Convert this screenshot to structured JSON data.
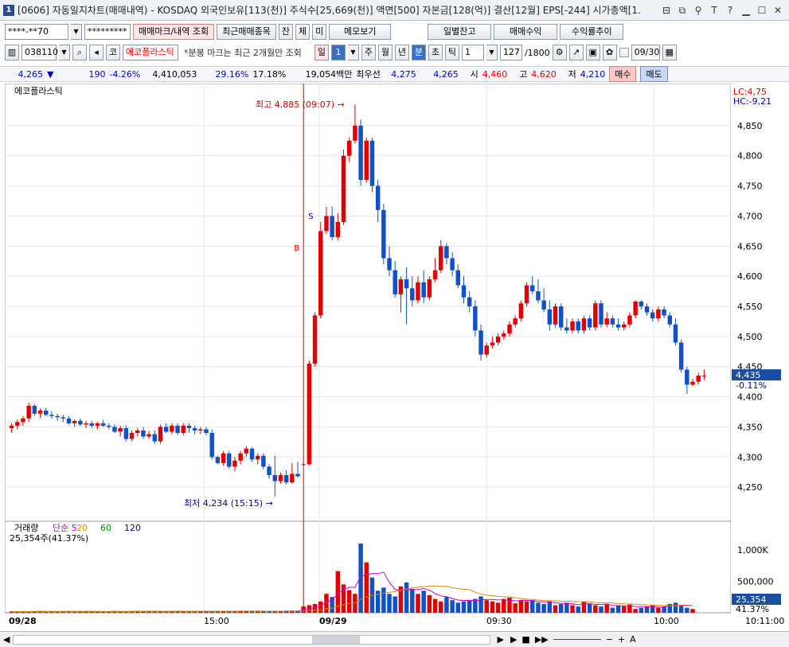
{
  "window": {
    "number": "1",
    "title": "[0606] 자동일지차트(매매내역) - KOSDAQ 외국인보유[113(천)] 주식수[25,669(천)] 액면[500] 자본금[128(억)] 결산[12월] EPS[-244] 시가총액[1."
  },
  "toolbar": {
    "account": "****-**70",
    "password": "*********",
    "btn_trade_mark": "매매마크/내역 조회",
    "btn_recent": "최근매매종목",
    "btn_jan": "잔",
    "btn_che": "체",
    "btn_mi": "미",
    "btn_memo": "메모보기",
    "btn_daily": "일별잔고",
    "btn_profit": "매매수익",
    "btn_return": "수익률추이"
  },
  "toolbar2": {
    "code": "038110",
    "market": "코",
    "name": "에코플라스틱",
    "note": "*분봉 마크는 최근 2개월만 조회",
    "period_il": "일",
    "period_num": "1",
    "ju": "주",
    "wol": "월",
    "nyeon": "년",
    "bun": "분",
    "cho": "초",
    "tick": "틱",
    "tick_num": "1",
    "count": "127",
    "count_total": "/1800",
    "date": "09/30"
  },
  "quote": {
    "price": "4,265",
    "arrow": "▼",
    "change": "190",
    "pct": "-4.26%",
    "volume": "4,410,053",
    "ratio": "29.16%",
    "ratio2": "17.18%",
    "amount": "19,054백만",
    "best_label": "최우선",
    "best_ask": "4,275",
    "best_bid": "4,265",
    "open_label": "시",
    "open": "4,460",
    "high_label": "고",
    "high": "4,620",
    "low_label": "저",
    "low": "4,210",
    "buy": "매수",
    "sell": "매도"
  },
  "chart_data": [
    {
      "type": "candlestick",
      "title": "에코플라스틱",
      "xlabel": "",
      "ylabel": "",
      "ylim": [
        4200,
        4900
      ],
      "y_ticks": [
        "4,850",
        "4,800",
        "4,750",
        "4,700",
        "4,650",
        "4,600",
        "4,550",
        "4,500",
        "4,450",
        "4,400",
        "4,350",
        "4,300",
        "4,250"
      ],
      "x_ticks": [
        "09/28",
        "15:00",
        "09/29",
        "09:30",
        "10:00",
        "10:11:00"
      ],
      "lc": "LC:4,75",
      "hc": "HC:-9,21",
      "current": "4,435",
      "current_pct": "-0.11%",
      "annotations": {
        "high": "최고 4,885 (09:07)",
        "low": "최저 4,234 (15:15)",
        "buy_mark": "B",
        "sell_mark": "S"
      },
      "candles": [
        [
          4348,
          4356,
          4340,
          4352
        ],
        [
          4352,
          4362,
          4346,
          4358
        ],
        [
          4358,
          4368,
          4352,
          4364
        ],
        [
          4364,
          4390,
          4358,
          4385
        ],
        [
          4385,
          4388,
          4368,
          4372
        ],
        [
          4372,
          4380,
          4365,
          4377
        ],
        [
          4377,
          4382,
          4368,
          4370
        ],
        [
          4370,
          4376,
          4364,
          4368
        ],
        [
          4368,
          4372,
          4360,
          4366
        ],
        [
          4366,
          4370,
          4358,
          4364
        ],
        [
          4364,
          4368,
          4354,
          4356
        ],
        [
          4356,
          4362,
          4350,
          4360
        ],
        [
          4360,
          4364,
          4352,
          4354
        ],
        [
          4354,
          4360,
          4348,
          4356
        ],
        [
          4356,
          4360,
          4348,
          4352
        ],
        [
          4352,
          4358,
          4346,
          4356
        ],
        [
          4356,
          4362,
          4350,
          4352
        ],
        [
          4352,
          4356,
          4346,
          4350
        ],
        [
          4350,
          4354,
          4340,
          4342
        ],
        [
          4342,
          4352,
          4334,
          4348
        ],
        [
          4348,
          4352,
          4326,
          4330
        ],
        [
          4330,
          4344,
          4326,
          4340
        ],
        [
          4340,
          4348,
          4334,
          4344
        ],
        [
          4344,
          4350,
          4330,
          4334
        ],
        [
          4334,
          4344,
          4330,
          4338
        ],
        [
          4338,
          4344,
          4322,
          4326
        ],
        [
          4326,
          4354,
          4322,
          4350
        ],
        [
          4350,
          4356,
          4340,
          4342
        ],
        [
          4342,
          4356,
          4338,
          4352
        ],
        [
          4352,
          4356,
          4336,
          4340
        ],
        [
          4340,
          4356,
          4336,
          4352
        ],
        [
          4352,
          4356,
          4340,
          4348
        ],
        [
          4348,
          4352,
          4338,
          4344
        ],
        [
          4344,
          4350,
          4338,
          4346
        ],
        [
          4346,
          4350,
          4336,
          4340
        ],
        [
          4340,
          4346,
          4296,
          4300
        ],
        [
          4300,
          4302,
          4288,
          4290
        ],
        [
          4290,
          4310,
          4286,
          4306
        ],
        [
          4306,
          4310,
          4280,
          4284
        ],
        [
          4284,
          4300,
          4276,
          4294
        ],
        [
          4294,
          4310,
          4288,
          4306
        ],
        [
          4306,
          4318,
          4300,
          4314
        ],
        [
          4314,
          4316,
          4292,
          4296
        ],
        [
          4296,
          4306,
          4288,
          4302
        ],
        [
          4302,
          4306,
          4280,
          4284
        ],
        [
          4284,
          4288,
          4264,
          4270
        ],
        [
          4270,
          4302,
          4234,
          4260
        ],
        [
          4260,
          4274,
          4256,
          4270
        ],
        [
          4270,
          4278,
          4254,
          4258
        ],
        [
          4258,
          4290,
          4256,
          4272
        ],
        [
          4272,
          4292,
          4266,
          4268
        ],
        [
          4288,
          4290,
          4286,
          4288
        ],
        [
          4288,
          4460,
          4286,
          4455
        ],
        [
          4455,
          4540,
          4450,
          4535
        ],
        [
          4535,
          4690,
          4530,
          4675
        ],
        [
          4675,
          4715,
          4670,
          4700
        ],
        [
          4700,
          4716,
          4660,
          4665
        ],
        [
          4665,
          4705,
          4660,
          4690
        ],
        [
          4690,
          4810,
          4685,
          4800
        ],
        [
          4800,
          4830,
          4790,
          4825
        ],
        [
          4825,
          4885,
          4820,
          4850
        ],
        [
          4850,
          4860,
          4750,
          4760
        ],
        [
          4760,
          4830,
          4755,
          4825
        ],
        [
          4825,
          4830,
          4740,
          4750
        ],
        [
          4750,
          4760,
          4690,
          4710
        ],
        [
          4710,
          4720,
          4620,
          4630
        ],
        [
          4630,
          4650,
          4600,
          4610
        ],
        [
          4610,
          4625,
          4565,
          4570
        ],
        [
          4570,
          4600,
          4540,
          4595
        ],
        [
          4595,
          4615,
          4520,
          4580
        ],
        [
          4580,
          4600,
          4550,
          4560
        ],
        [
          4560,
          4600,
          4555,
          4590
        ],
        [
          4590,
          4610,
          4555,
          4565
        ],
        [
          4565,
          4600,
          4560,
          4595
        ],
        [
          4595,
          4630,
          4590,
          4610
        ],
        [
          4610,
          4660,
          4605,
          4650
        ],
        [
          4650,
          4655,
          4620,
          4630
        ],
        [
          4630,
          4640,
          4600,
          4610
        ],
        [
          4610,
          4620,
          4580,
          4585
        ],
        [
          4585,
          4600,
          4555,
          4565
        ],
        [
          4565,
          4575,
          4540,
          4550
        ],
        [
          4550,
          4560,
          4500,
          4510
        ],
        [
          4510,
          4520,
          4460,
          4470
        ],
        [
          4470,
          4490,
          4465,
          4485
        ],
        [
          4485,
          4500,
          4480,
          4490
        ],
        [
          4490,
          4505,
          4485,
          4500
        ],
        [
          4500,
          4510,
          4495,
          4505
        ],
        [
          4505,
          4525,
          4500,
          4520
        ],
        [
          4520,
          4535,
          4515,
          4530
        ],
        [
          4530,
          4560,
          4525,
          4555
        ],
        [
          4555,
          4590,
          4550,
          4585
        ],
        [
          4585,
          4600,
          4570,
          4575
        ],
        [
          4575,
          4595,
          4555,
          4560
        ],
        [
          4560,
          4580,
          4540,
          4545
        ],
        [
          4545,
          4560,
          4510,
          4520
        ],
        [
          4520,
          4555,
          4515,
          4550
        ],
        [
          4550,
          4555,
          4510,
          4515
        ],
        [
          4515,
          4530,
          4505,
          4510
        ],
        [
          4510,
          4530,
          4505,
          4525
        ],
        [
          4525,
          4530,
          4505,
          4510
        ],
        [
          4510,
          4535,
          4505,
          4530
        ],
        [
          4530,
          4535,
          4510,
          4515
        ],
        [
          4515,
          4560,
          4510,
          4555
        ],
        [
          4555,
          4560,
          4515,
          4520
        ],
        [
          4520,
          4540,
          4515,
          4530
        ],
        [
          4530,
          4535,
          4515,
          4520
        ],
        [
          4520,
          4530,
          4510,
          4515
        ],
        [
          4515,
          4525,
          4510,
          4520
        ],
        [
          4520,
          4540,
          4515,
          4535
        ],
        [
          4535,
          4560,
          4530,
          4558
        ],
        [
          4558,
          4560,
          4545,
          4550
        ],
        [
          4550,
          4555,
          4535,
          4540
        ],
        [
          4540,
          4545,
          4525,
          4530
        ],
        [
          4530,
          4550,
          4525,
          4545
        ],
        [
          4545,
          4550,
          4530,
          4535
        ],
        [
          4535,
          4540,
          4515,
          4520
        ],
        [
          4520,
          4530,
          4485,
          4490
        ],
        [
          4490,
          4495,
          4440,
          4445
        ],
        [
          4445,
          4450,
          4405,
          4420
        ],
        [
          4420,
          4430,
          4418,
          4425
        ],
        [
          4425,
          4440,
          4420,
          4435
        ],
        [
          4435,
          4445,
          4428,
          4435
        ]
      ]
    },
    {
      "type": "bar",
      "title": "거래량",
      "series_labels": [
        "단순 5",
        "20",
        "60",
        "120"
      ],
      "series_colors": [
        "#d000d0",
        "#d09000",
        "#009000",
        "#000080"
      ],
      "volume_text": "25,354주(41.37%)",
      "y_ticks": [
        "1,000K",
        "500,000"
      ],
      "current_volume": "25,354",
      "current_pct": "41.37%",
      "values": [
        20,
        15,
        25,
        18,
        22,
        30,
        14,
        20,
        18,
        25,
        28,
        16,
        22,
        18,
        24,
        20,
        16,
        20,
        28,
        18,
        24,
        20,
        30,
        26,
        18,
        22,
        28,
        20,
        24,
        30,
        22,
        18,
        26,
        30,
        24,
        20,
        28,
        26,
        22,
        30,
        32,
        24,
        28,
        26,
        22,
        30,
        28,
        24,
        34,
        30,
        26,
        100,
        120,
        140,
        180,
        300,
        250,
        660,
        450,
        360,
        300,
        1100,
        800,
        560,
        350,
        400,
        300,
        260,
        420,
        480,
        380,
        300,
        350,
        280,
        220,
        180,
        250,
        200,
        160,
        180,
        200,
        220,
        260,
        200,
        180,
        160,
        220,
        240,
        150,
        200,
        180,
        200,
        160,
        140,
        180,
        120,
        140,
        160,
        120,
        100,
        180,
        150,
        120,
        100,
        140,
        80,
        120,
        100,
        130,
        60,
        80,
        100,
        120,
        80,
        100,
        140,
        160,
        120,
        80,
        60
      ]
    }
  ]
}
